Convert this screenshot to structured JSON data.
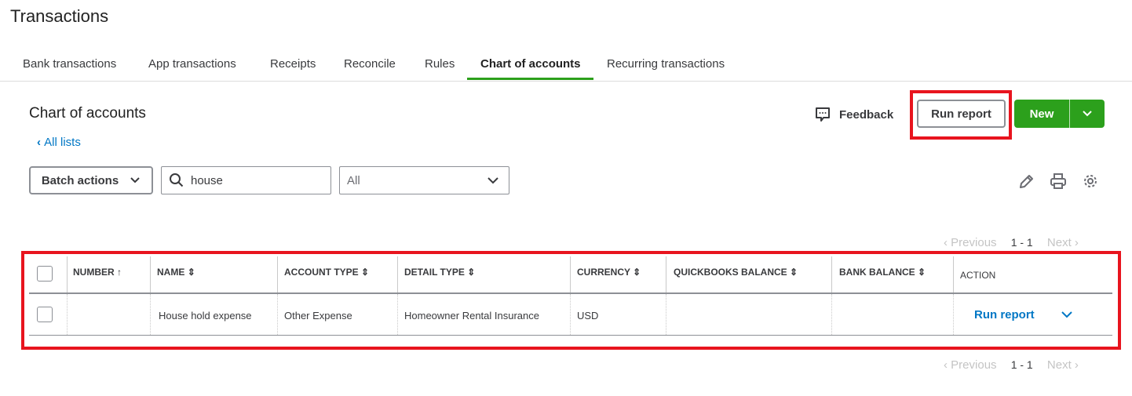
{
  "page_title": "Transactions",
  "tabs": [
    "Bank transactions",
    "App transactions",
    "Receipts",
    "Reconcile",
    "Rules",
    "Chart of accounts",
    "Recurring transactions"
  ],
  "section_title": "Chart of accounts",
  "back_link": "All lists",
  "feedback": "Feedback",
  "run_report": "Run report",
  "new_button": "New",
  "batch_actions": "Batch actions",
  "search_value": "house",
  "filter_value": "All",
  "pagination": {
    "previous": "Previous",
    "range": "1 - 1",
    "next": "Next"
  },
  "table": {
    "headers": [
      "NUMBER",
      "NAME",
      "ACCOUNT TYPE",
      "DETAIL TYPE",
      "CURRENCY",
      "QUICKBOOKS BALANCE",
      "BANK BALANCE",
      "ACTION"
    ],
    "rows": [
      {
        "number": "",
        "name": "House hold expense",
        "account_type": "Other Expense",
        "detail_type": "Homeowner Rental Insurance",
        "currency": "USD",
        "qb_balance": "",
        "bank_balance": "",
        "action": "Run report"
      }
    ]
  },
  "colors": {
    "accent": "#2ca01c",
    "link": "#0077c5",
    "highlight": "#e8141e"
  }
}
